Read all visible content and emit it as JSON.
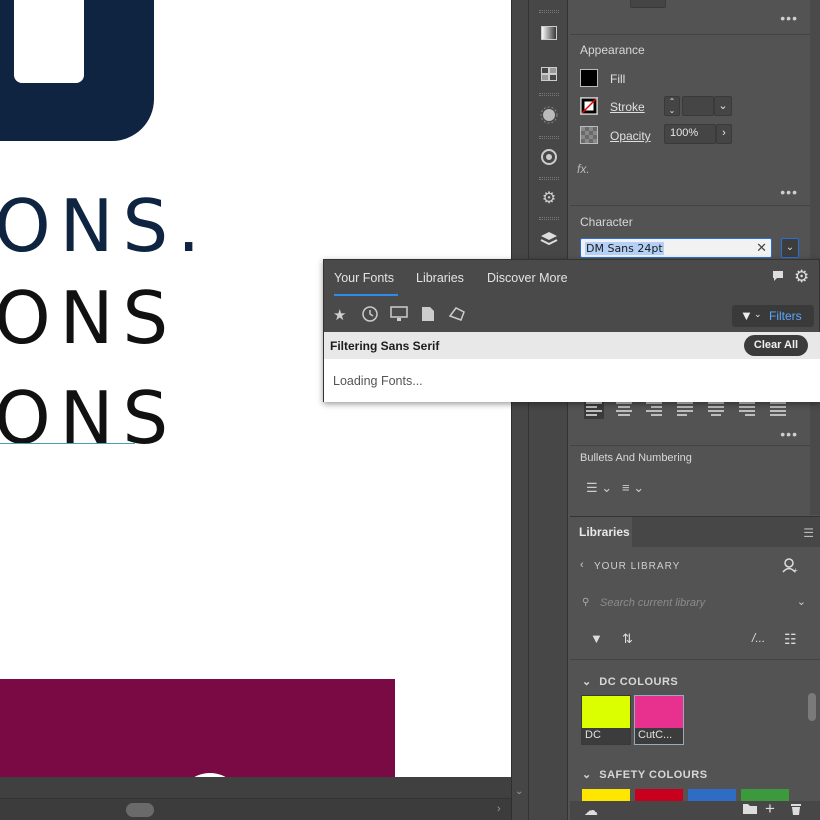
{
  "canvas": {
    "line1": "ONS.",
    "line2": "ONS",
    "line3": "ONS"
  },
  "appearance": {
    "title": "Appearance",
    "fill_label": "Fill",
    "stroke_label": "Stroke",
    "opacity_label": "Opacity",
    "opacity_value": "100%",
    "fx_label": "fx."
  },
  "character": {
    "title": "Character",
    "font_value": "DM Sans 24pt"
  },
  "font_popup": {
    "tabs": [
      "Your Fonts",
      "Libraries",
      "Discover More"
    ],
    "filters_label": "Filters",
    "filter_text": "Filtering Sans Serif",
    "clear_all": "Clear All",
    "loading": "Loading Fonts..."
  },
  "bullets": {
    "title": "Bullets And Numbering"
  },
  "libraries": {
    "tab": "Libraries",
    "your_library": "YOUR LIBRARY",
    "search_placeholder": "Search current library",
    "groups": [
      {
        "name": "DC COLOURS",
        "swatches": [
          {
            "name": "DC",
            "color": "#dcff00"
          },
          {
            "name": "CutC...",
            "color": "#e8318e"
          }
        ]
      },
      {
        "name": "SAFETY COLOURS",
        "swatches": [
          {
            "color": "#ffe600"
          },
          {
            "color": "#c8001e"
          },
          {
            "color": "#2f6cc4"
          },
          {
            "color": "#3c9a3c"
          }
        ]
      }
    ]
  },
  "colors": {
    "accent": "#2d8ceb",
    "canvas_navy": "#0e2440",
    "canvas_maroon": "#7a0a43"
  }
}
